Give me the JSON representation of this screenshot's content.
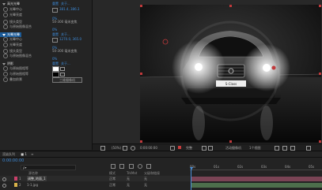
{
  "effects": {
    "groups": [
      {
        "name": "高光光晕",
        "reset": "重置",
        "about": "关于..."
      },
      {
        "name": "光晕光晕",
        "reset": "重置",
        "about": "关于..."
      },
      {
        "name": "阴影",
        "reset": "重置",
        "about": "关于..."
      }
    ],
    "row_labels": [
      "光晕中心",
      "光晕亮度",
      "镜头类型",
      "与原始图像混合"
    ],
    "second_row_labels": [
      "光晕中心",
      "光晕亮度",
      "镜头类型",
      "与原始图像混合"
    ],
    "shadow_labels": [
      "与原始图相等",
      "与原始图相等",
      "叠加前景"
    ],
    "values": {
      "center1": "381.4, 386.3",
      "brightness1": "0%",
      "lens1": "50-300 毫米变焦",
      "blend1": "0%",
      "center2": "1270.0, 365.0",
      "brightness2": "0%",
      "lens2": "50-300 毫米变焦",
      "blend2": "0%",
      "color_a": "#ffffff",
      "color_b": "#000000",
      "button": "三维摄像机"
    }
  },
  "viewer": {
    "badge": "S-Class",
    "zoom": "(50%)",
    "timecode": "0:00:00:00",
    "quality": "完整",
    "camera": "活动摄像机",
    "views": "1个视图"
  },
  "timeline": {
    "tab": "渲染队列",
    "comp_tab": "1",
    "timecode": "0:00:00:00",
    "search_placeholder": "ρ▾",
    "col_name": "源名称",
    "col_mode": "模式",
    "col_trkmat": "TrkMat",
    "col_parent": "父级和链接",
    "layers": [
      {
        "num": "1",
        "name": "调整_地面_1",
        "mode": "正常",
        "trk": "无",
        "parent": "无",
        "color": "#c9406a"
      },
      {
        "num": "2",
        "name": "1-1.jpg",
        "mode": "正常",
        "trk": "无",
        "parent": "无",
        "color": "#d8b24a"
      }
    ],
    "ruler_ticks": [
      "00s",
      "01s",
      "02s",
      "03s",
      "04s",
      "05s"
    ],
    "bar_colors": [
      "#7a4455",
      "#4d6f4c"
    ]
  }
}
